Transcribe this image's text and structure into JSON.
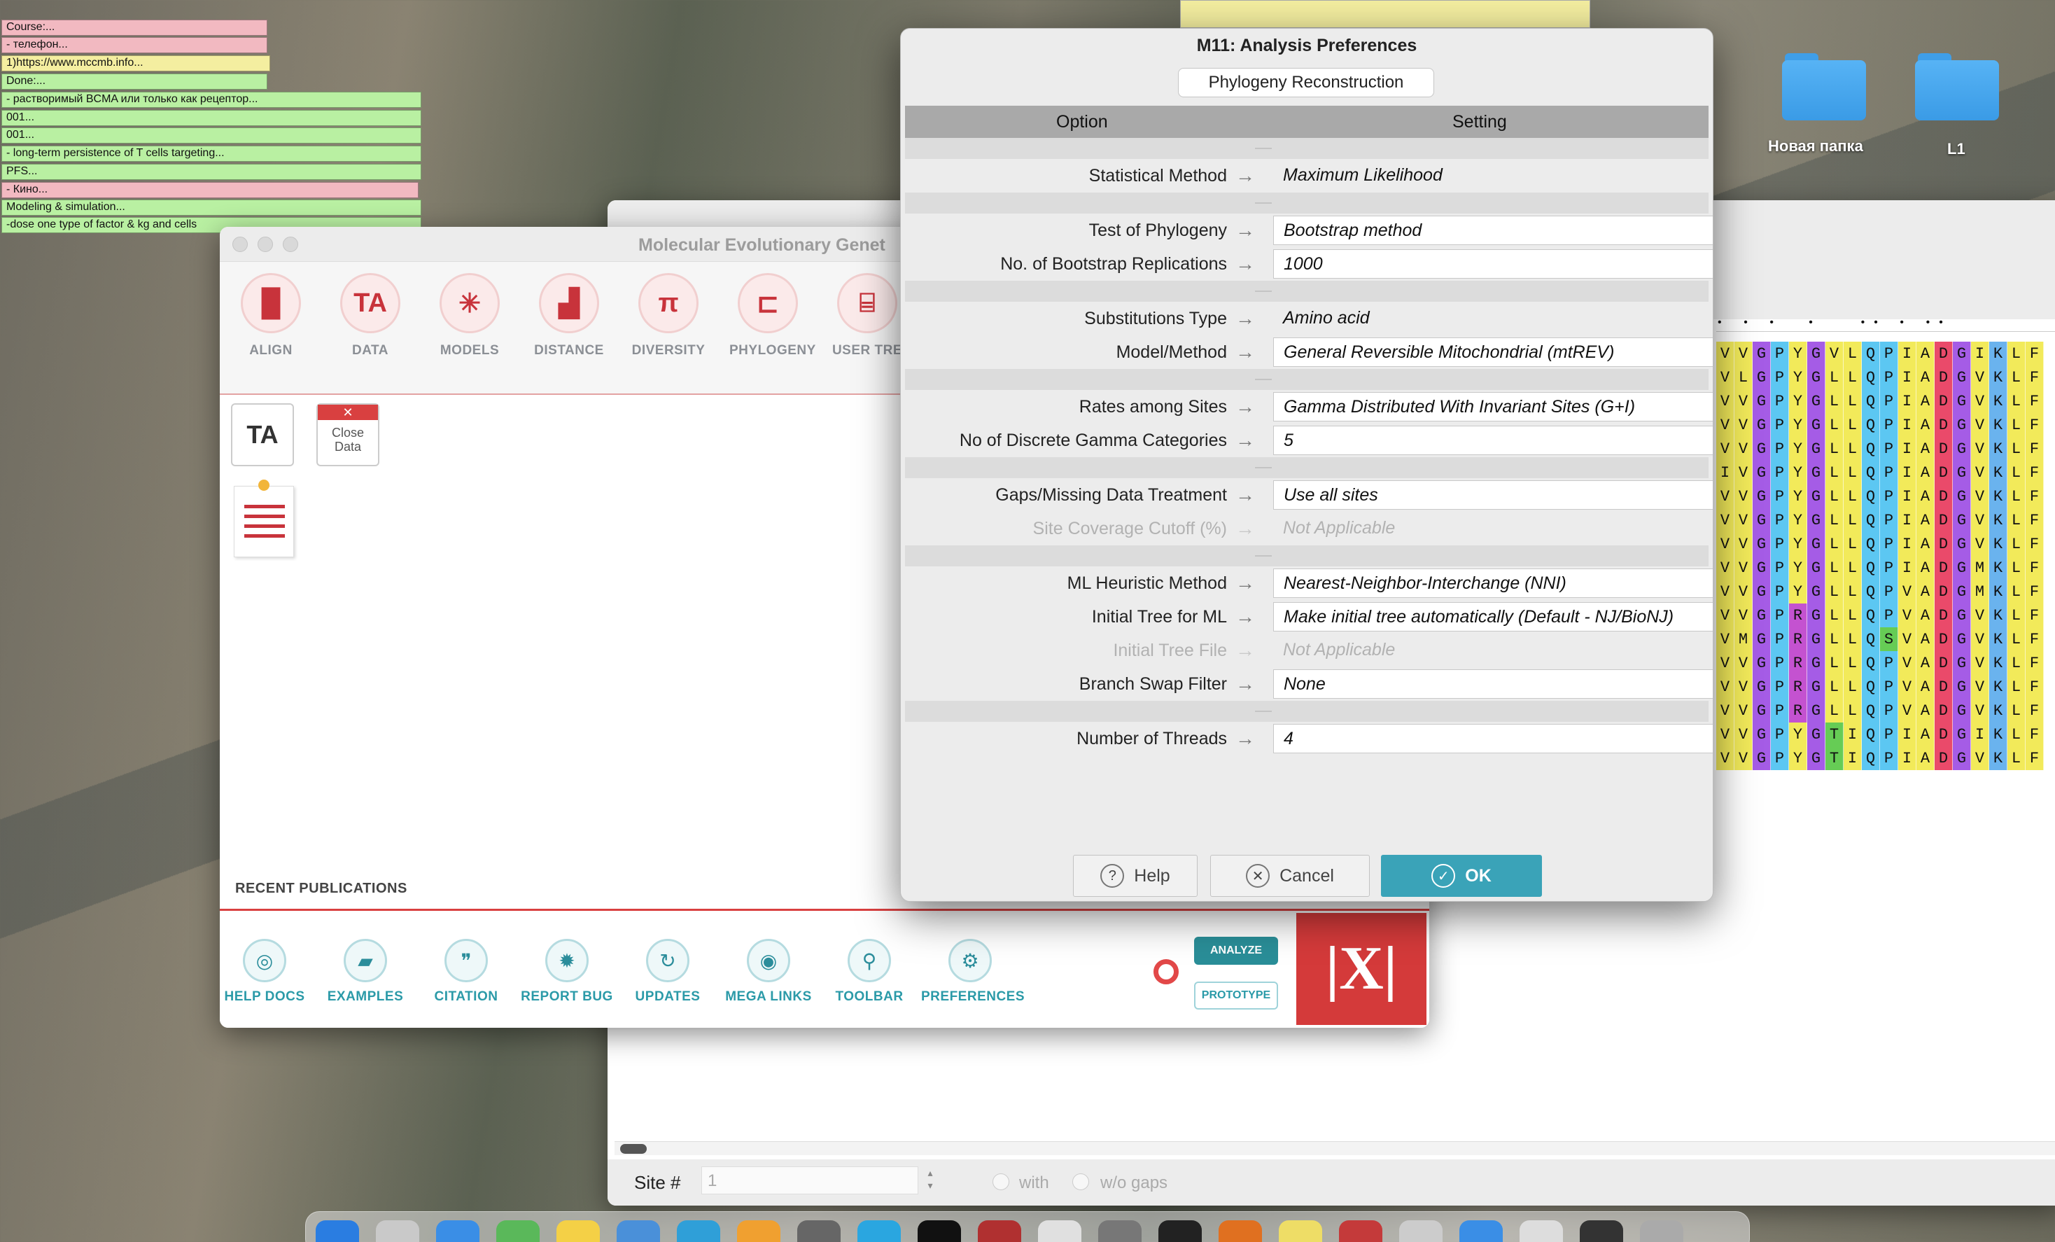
{
  "desktop": {
    "notes": [
      {
        "text": "Course:...",
        "color": "#f2b9c1"
      },
      {
        "text": "- телефон...",
        "color": "#f2b9c1"
      },
      {
        "text": "1)https://www.mccmb.info...",
        "color": "#f4eea0"
      },
      {
        "text": "Done:...",
        "color": "#b9f0a2"
      },
      {
        "text": "- растворимый BCMA или только как рецептор...",
        "color": "#b9f0a2"
      },
      {
        "text": "001...",
        "color": "#b9f0a2"
      },
      {
        "text": "001...",
        "color": "#b9f0a2"
      },
      {
        "text": "- long-term persistence of T cells targeting...",
        "color": "#b9f0a2"
      },
      {
        "text": "PFS...",
        "color": "#b9f0a2"
      },
      {
        "text": "- Кино...",
        "color": "#f2b9c1"
      },
      {
        "text": "Modeling & simulation...",
        "color": "#b9f0a2"
      },
      {
        "text": "-dose one type of factor & kg and cells",
        "color": "#b9f0a2"
      }
    ],
    "folders": [
      {
        "label": "Новая папка",
        "icon": "folder-icon"
      },
      {
        "label": "L1",
        "icon": "folder-icon"
      }
    ]
  },
  "mega_window": {
    "title": "Molecular Evolutionary Genet",
    "toolbar": [
      {
        "label": "ALIGN",
        "icon": "align-icon"
      },
      {
        "label": "DATA",
        "icon": "data-icon"
      },
      {
        "label": "MODELS",
        "icon": "models-icon"
      },
      {
        "label": "DISTANCE",
        "icon": "distance-icon"
      },
      {
        "label": "DIVERSITY",
        "icon": "diversity-icon"
      },
      {
        "label": "PHYLOGENY",
        "icon": "phylogeny-icon"
      },
      {
        "label": "USER TRE",
        "icon": "user-tree-icon"
      }
    ],
    "data_icons": {
      "ta": "TA",
      "close_data": "Close\nData"
    },
    "recent_publications": "RECENT PUBLICATIONS",
    "bottom_tools": [
      {
        "label": "HELP DOCS",
        "icon": "lifebuoy-icon"
      },
      {
        "label": "EXAMPLES",
        "icon": "folder-open-icon"
      },
      {
        "label": "CITATION",
        "icon": "quote-icon"
      },
      {
        "label": "REPORT BUG",
        "icon": "bug-icon"
      },
      {
        "label": "UPDATES",
        "icon": "refresh-icon"
      },
      {
        "label": "MEGA LINKS",
        "icon": "globe-icon"
      },
      {
        "label": "TOOLBAR",
        "icon": "wrench-icon"
      },
      {
        "label": "PREFERENCES",
        "icon": "gear-icon"
      }
    ],
    "mode_buttons": {
      "analyze": "ANALYZE",
      "prototype": "PROTOTYPE"
    },
    "logo": "|X|"
  },
  "alignment_window": {
    "site_label": "Site #",
    "site_value": "1",
    "with_label": "with",
    "without_label": "w/o gaps",
    "rows": [
      "VVGPYGVLQPIADGIKLF",
      "VLGPYGLLQPIADGVKLF",
      "VVGPYGLLQPIADGVKLF",
      "VVGPYGLLQPIADGVKLF",
      "VVGPYGLLQPIADGVKLF",
      "IVGPYGLLQPIADGVKLF",
      "VVGPYGLLQPIADGVKLF",
      "VVGPYGLLQPIADGVKLF",
      "VVGPYGLLQPIADGVKLF",
      "VVGPYGLLQPIADGMKLF",
      "VVGPYGLLQPVADGMKLF",
      "VVGPRGLLQPVADGVKLF",
      "VMGPRGLLQSVADGVKLF",
      "VVGPRGLLQPVADGVKLF",
      "VVGPRGLLQPVADGVKLF",
      "VVGPRGLLQPVADGVKLF",
      "VVGPYGTIQPIADGIKLF",
      "VVGPYGTIQPIADGVKLF"
    ],
    "conserved_marks": "• • •  •   •• • ••"
  },
  "dialog": {
    "title": "M11: Analysis Preferences",
    "tab": "Phylogeny Reconstruction",
    "col_option": "Option",
    "col_setting": "Setting",
    "rows": [
      {
        "type": "sep"
      },
      {
        "option": "Statistical Method",
        "setting": "Maximum Likelihood",
        "box": false,
        "disabled": false
      },
      {
        "type": "sep"
      },
      {
        "option": "Test of Phylogeny",
        "setting": "Bootstrap method",
        "box": true,
        "disabled": false
      },
      {
        "option": "No. of Bootstrap Replications",
        "setting": "1000",
        "box": true,
        "disabled": false
      },
      {
        "type": "sep"
      },
      {
        "option": "Substitutions Type",
        "setting": "Amino acid",
        "box": false,
        "disabled": false
      },
      {
        "option": "Model/Method",
        "setting": "General Reversible Mitochondrial (mtREV)",
        "box": true,
        "disabled": false
      },
      {
        "type": "sep"
      },
      {
        "option": "Rates among Sites",
        "setting": "Gamma Distributed With Invariant Sites (G+I)",
        "box": true,
        "disabled": false
      },
      {
        "option": "No of Discrete Gamma Categories",
        "setting": "5",
        "box": true,
        "disabled": false
      },
      {
        "type": "sep"
      },
      {
        "option": "Gaps/Missing Data Treatment",
        "setting": "Use all sites",
        "box": true,
        "disabled": false
      },
      {
        "option": "Site Coverage Cutoff (%)",
        "setting": "Not Applicable",
        "box": false,
        "disabled": true
      },
      {
        "type": "sep"
      },
      {
        "option": "ML Heuristic Method",
        "setting": "Nearest-Neighbor-Interchange (NNI)",
        "box": true,
        "disabled": false
      },
      {
        "option": "Initial Tree for ML",
        "setting": "Make initial tree automatically (Default - NJ/BioNJ)",
        "box": true,
        "disabled": false
      },
      {
        "option": "Initial Tree File",
        "setting": "Not Applicable",
        "box": false,
        "disabled": true
      },
      {
        "option": "Branch Swap Filter",
        "setting": "None",
        "box": true,
        "disabled": false
      },
      {
        "type": "sep"
      },
      {
        "option": "Number of Threads",
        "setting": "4",
        "box": true,
        "disabled": false
      }
    ],
    "buttons": {
      "help": "Help",
      "cancel": "Cancel",
      "ok": "OK"
    },
    "accent": "#3aa3b8"
  },
  "colors": {
    "aa": {
      "V": "#f2ea5a",
      "I": "#f2ea5a",
      "L": "#f2ea5a",
      "M": "#f2ea5a",
      "F": "#f2ea5a",
      "G": "#a55ce6",
      "P": "#5cc7f2",
      "Y": "#f2ea5a",
      "R": "#c452d0",
      "Q": "#5cc7f2",
      "A": "#f2ea5a",
      "D": "#ea4a6a",
      "K": "#6ab3ee",
      "T": "#66cc55",
      "S": "#66cc55"
    }
  }
}
